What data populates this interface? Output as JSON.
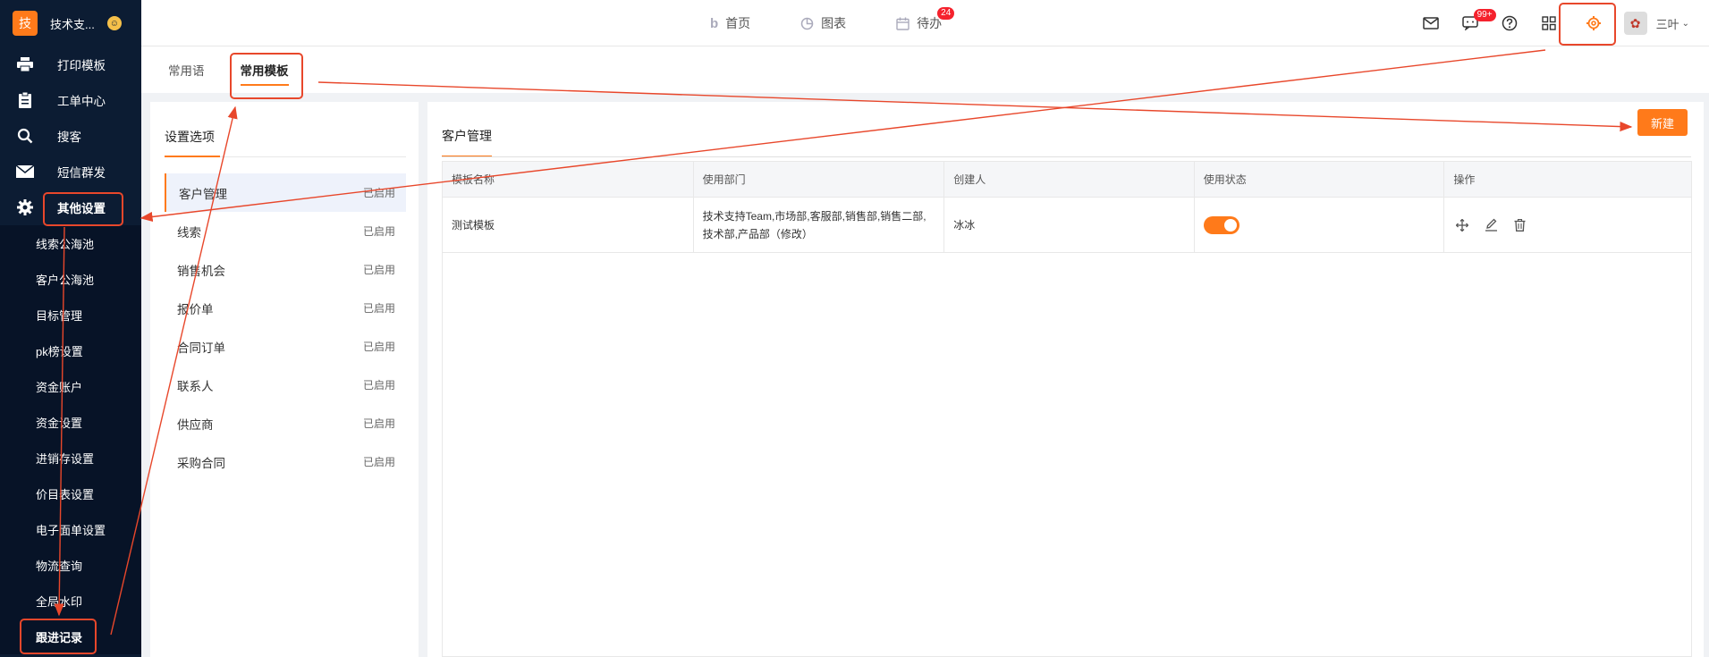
{
  "brand": {
    "logo": "技",
    "name": "技术支..."
  },
  "sidebar": {
    "items": [
      {
        "icon": "printer-icon",
        "label": "打印模板"
      },
      {
        "icon": "clipboard-icon",
        "label": "工单中心"
      },
      {
        "icon": "search-icon",
        "label": "搜客"
      },
      {
        "icon": "mail-icon",
        "label": "短信群发"
      },
      {
        "icon": "gear-icon",
        "label": "其他设置"
      }
    ],
    "submenu": [
      "线索公海池",
      "客户公海池",
      "目标管理",
      "pk榜设置",
      "资金账户",
      "资金设置",
      "进销存设置",
      "价目表设置",
      "电子面单设置",
      "物流查询",
      "全局水印",
      "跟进记录"
    ]
  },
  "topnav": {
    "home": "首页",
    "charts": "图表",
    "todo": "待办",
    "todo_badge": "24",
    "chat_badge": "99+",
    "user": "三叶"
  },
  "subtabs": [
    "常用语",
    "常用模板"
  ],
  "settings": {
    "title": "设置选项",
    "items": [
      {
        "label": "客户管理",
        "status": "已启用"
      },
      {
        "label": "线索",
        "status": "已启用"
      },
      {
        "label": "销售机会",
        "status": "已启用"
      },
      {
        "label": "报价单",
        "status": "已启用"
      },
      {
        "label": "合同订单",
        "status": "已启用"
      },
      {
        "label": "联系人",
        "status": "已启用"
      },
      {
        "label": "供应商",
        "status": "已启用"
      },
      {
        "label": "采购合同",
        "status": "已启用"
      }
    ]
  },
  "main": {
    "tab": "客户管理",
    "new_button": "新建",
    "columns": [
      "模板名称",
      "使用部门",
      "创建人",
      "使用状态",
      "操作"
    ],
    "rows": [
      {
        "name": "测试模板",
        "dept_line1": "技术支持Team,市场部,客服部,销售部,销售二部,",
        "dept_line2": "技术部,产品部（修改）",
        "creator": "冰冰",
        "enabled": true
      }
    ]
  },
  "colors": {
    "accent": "#ff7a1a",
    "sidebar": "#0c1c33",
    "annotation": "#e8472b"
  }
}
